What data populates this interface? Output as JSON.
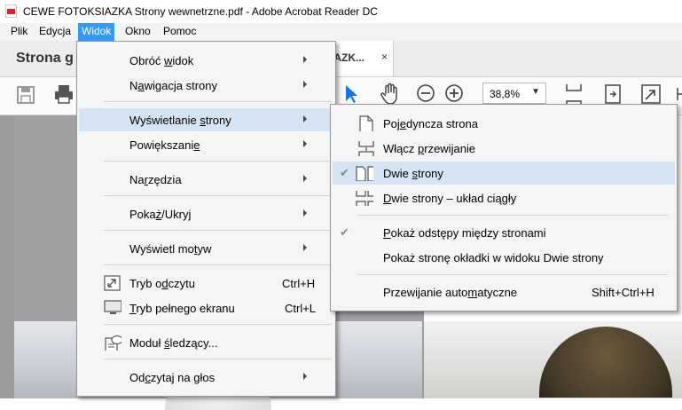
{
  "window": {
    "title": "CEWE FOTOKSIAZKA Strony wewnetrzne.pdf - Adobe Acrobat Reader DC"
  },
  "menubar": [
    {
      "label": "Plik"
    },
    {
      "label": "Edycja"
    },
    {
      "label": "Widok"
    },
    {
      "label": "Okno"
    },
    {
      "label": "Pomoc"
    }
  ],
  "tabs": {
    "home": "Strona g",
    "doc": "IAZK...",
    "close": "×"
  },
  "toolbar": {
    "zoom": "38,8%",
    "zoom_caret": "▼"
  },
  "view_menu": [
    {
      "pre": "Obróć ",
      "u": "w",
      "post": "idok",
      "submenu": true
    },
    {
      "pre": "N",
      "u": "a",
      "post": "wigacja strony",
      "submenu": true
    },
    {
      "pre": "Wyświetlanie ",
      "u": "s",
      "post": "trony",
      "submenu": true
    },
    {
      "pre": "Powiększani",
      "u": "e",
      "post": "",
      "submenu": true
    },
    {
      "pre": "Na",
      "u": "r",
      "post": "zędzia",
      "submenu": true
    },
    {
      "pre": "Poka",
      "u": "ż",
      "post": "/Ukryj",
      "submenu": true
    },
    {
      "pre": "Wyświetl mo",
      "u": "t",
      "post": "yw",
      "submenu": true
    },
    {
      "pre": "Tryb o",
      "u": "d",
      "post": "czytu",
      "shortcut": "Ctrl+H"
    },
    {
      "pre": "",
      "u": "T",
      "post": "ryb pełnego ekranu",
      "shortcut": "Ctrl+L"
    },
    {
      "pre": "Moduł ",
      "u": "ś",
      "post": "ledzący...",
      "submenu": false
    },
    {
      "pre": "Od",
      "u": "c",
      "post": "zytaj na głos",
      "submenu": true
    }
  ],
  "page_display_submenu": [
    {
      "pre": "Poj",
      "u": "e",
      "post": "dyncza strona",
      "checked": false
    },
    {
      "pre": "Włącz ",
      "u": "p",
      "post": "rzewijanie",
      "checked": false
    },
    {
      "pre": "Dwie ",
      "u": "s",
      "post": "trony",
      "checked": true
    },
    {
      "pre": "",
      "u": "D",
      "post": "wie strony – układ ciągły",
      "checked": false
    },
    {
      "pre": "",
      "u": "P",
      "post": "okaż odstępy między stronami",
      "checked": true
    },
    {
      "pre": "Pokaż stronę okładki w widoku Dwie strony",
      "u": "",
      "post": "",
      "checked": false
    },
    {
      "pre": "Przewijanie auto",
      "u": "m",
      "post": "atyczne",
      "shortcut": "Shift+Ctrl+H"
    }
  ],
  "glyphs": {
    "check": "✔"
  }
}
